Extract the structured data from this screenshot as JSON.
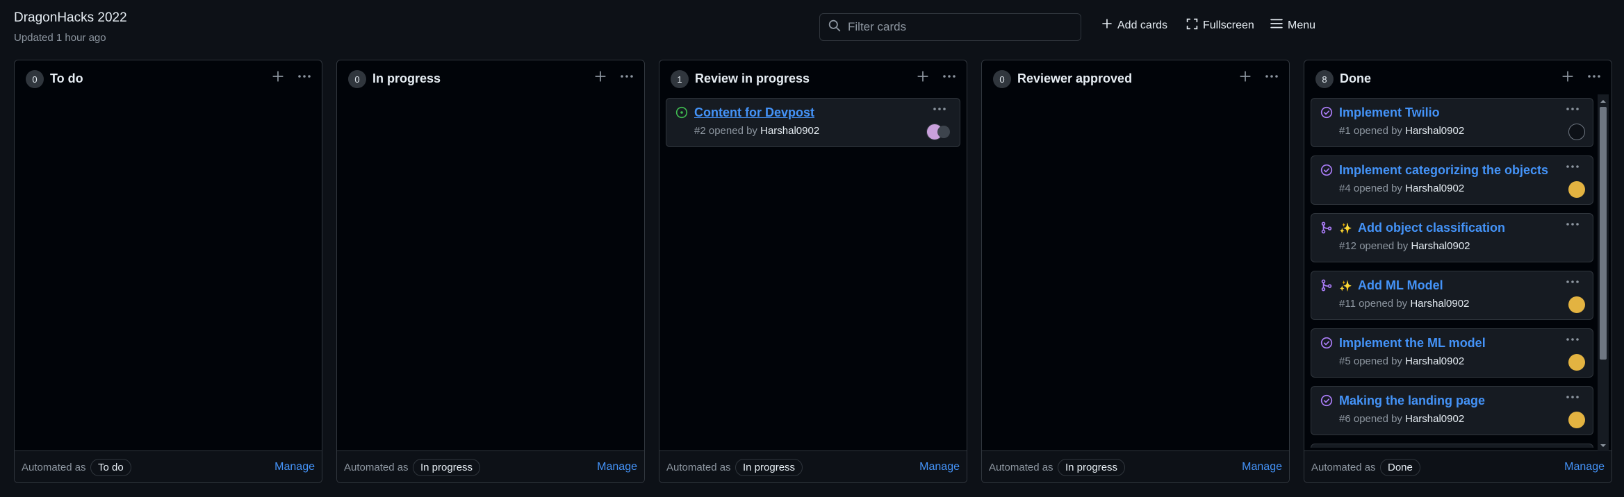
{
  "board": {
    "title": "DragonHacks 2022",
    "updated": "Updated 1 hour ago",
    "filter_placeholder": "Filter cards",
    "add_cards": "Add cards",
    "fullscreen": "Fullscreen",
    "menu": "Menu"
  },
  "columns": [
    {
      "count": "0",
      "title": "To do",
      "automated_label": "Automated as",
      "automated_value": "To do",
      "manage": "Manage",
      "cards": []
    },
    {
      "count": "0",
      "title": "In progress",
      "automated_label": "Automated as",
      "automated_value": "In progress",
      "manage": "Manage",
      "cards": []
    },
    {
      "count": "1",
      "title": "Review in progress",
      "automated_label": "Automated as",
      "automated_value": "In progress",
      "manage": "Manage",
      "cards": [
        {
          "title": "Content for Devpost",
          "number": "#2",
          "opened_by": "opened by",
          "author": "Harshal0902",
          "icon": "issue-open-icon"
        }
      ]
    },
    {
      "count": "0",
      "title": "Reviewer approved",
      "automated_label": "Automated as",
      "automated_value": "In progress",
      "manage": "Manage",
      "cards": []
    },
    {
      "count": "8",
      "title": "Done",
      "automated_label": "Automated as",
      "automated_value": "Done",
      "manage": "Manage",
      "cards": [
        {
          "title": "Implement Twilio",
          "number": "#1",
          "opened_by": "opened by",
          "author": "Harshal0902",
          "icon": "issue-closed-icon"
        },
        {
          "title": "Implement categorizing the objects",
          "number": "#4",
          "opened_by": "opened by",
          "author": "Harshal0902",
          "icon": "issue-closed-icon"
        },
        {
          "title": "Add object classification",
          "number": "#12",
          "opened_by": "opened by",
          "author": "Harshal0902",
          "icon": "pull-request-merged-icon",
          "emoji": "✨"
        },
        {
          "title": "Add ML Model",
          "number": "#11",
          "opened_by": "opened by",
          "author": "Harshal0902",
          "icon": "pull-request-merged-icon",
          "emoji": "✨"
        },
        {
          "title": "Implement the ML model",
          "number": "#5",
          "opened_by": "opened by",
          "author": "Harshal0902",
          "icon": "issue-closed-icon"
        },
        {
          "title": "Making the landing page",
          "number": "#6",
          "opened_by": "opened by",
          "author": "Harshal0902",
          "icon": "issue-closed-icon"
        }
      ]
    }
  ],
  "colors": {
    "background": "#0d1117",
    "column_bg": "#010409",
    "card_bg": "#161b22",
    "border": "#30363d",
    "link": "#4493f8",
    "muted": "#8d96a0",
    "open_green": "#3fb950",
    "closed_purple": "#ab7df8"
  }
}
